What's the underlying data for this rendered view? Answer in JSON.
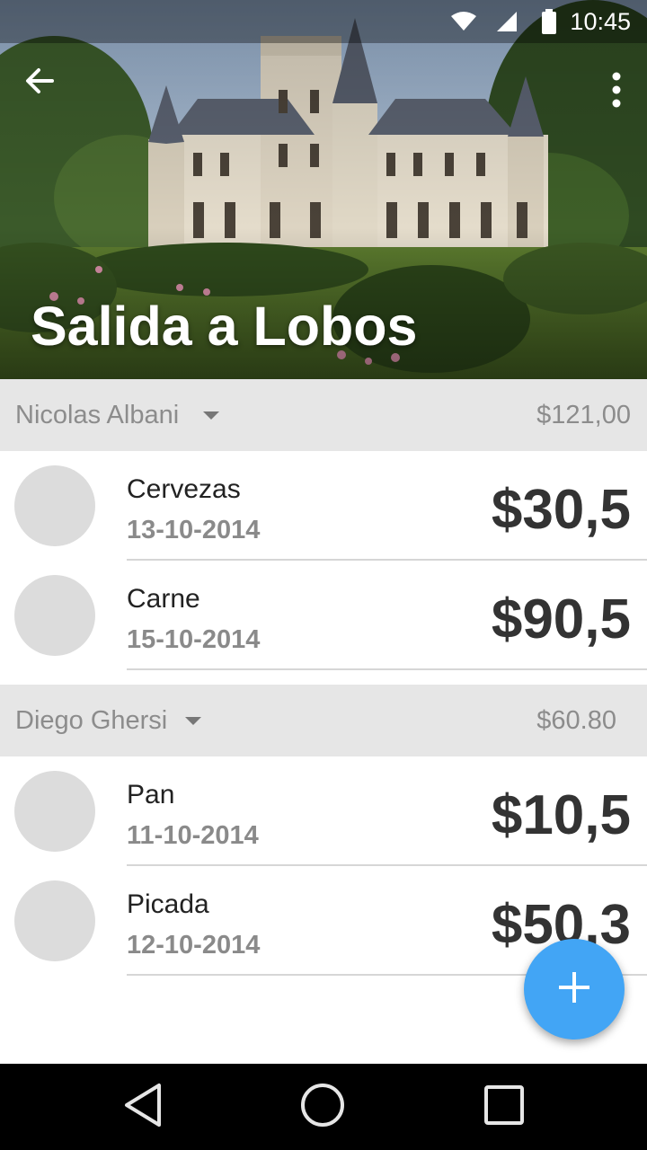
{
  "status_bar": {
    "time": "10:45",
    "icons": [
      "wifi-icon",
      "cell-signal-icon",
      "battery-icon"
    ]
  },
  "toolbar": {
    "back_icon": "arrow-back-icon",
    "overflow_icon": "more-vert-icon"
  },
  "header": {
    "title": "Salida a Lobos",
    "image": "castle-photo"
  },
  "groups": [
    {
      "name": "Nicolas Albani",
      "total": "$121,00",
      "items": [
        {
          "name": "Cervezas",
          "date": "13-10-2014",
          "amount": "$30,5"
        },
        {
          "name": "Carne",
          "date": "15-10-2014",
          "amount": "$90,5"
        }
      ]
    },
    {
      "name": "Diego Ghersi",
      "total": "$60.80",
      "items": [
        {
          "name": "Pan",
          "date": "11-10-2014",
          "amount": "$10,5"
        },
        {
          "name": "Picada",
          "date": "12-10-2014",
          "amount": "$50,3"
        }
      ]
    }
  ],
  "fab": {
    "icon": "add-icon",
    "color": "#42a5f5"
  },
  "nav_bar": {
    "icons": [
      "back-triangle-icon",
      "home-circle-icon",
      "recents-square-icon"
    ]
  },
  "colors": {
    "group_header_bg": "#e6e6e6",
    "amount_text": "#333333",
    "secondary_text": "#8a8a8a"
  }
}
